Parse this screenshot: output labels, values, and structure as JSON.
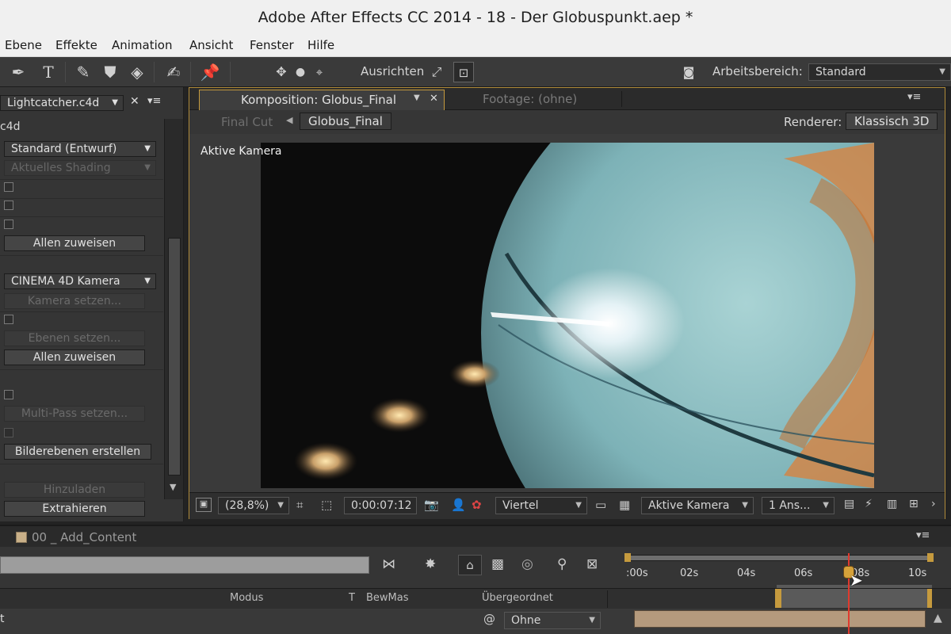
{
  "window": {
    "title": "Adobe After Effects CC 2014 - 18 - Der Globuspunkt.aep *"
  },
  "menu": {
    "items": [
      "Ebene",
      "Effekte",
      "Animation",
      "Ansicht",
      "Fenster",
      "Hilfe"
    ]
  },
  "toolbar": {
    "align_label": "Ausrichten",
    "workspace_label": "Arbeitsbereich:",
    "workspace_value": "Standard"
  },
  "effects_panel": {
    "tab_label": "Lightcatcher.c4d",
    "file_label": "c4d",
    "renderer_select": "Standard (Entwurf)",
    "shading_select": "Aktuelles Shading",
    "assign_all_1": "Allen zuweisen",
    "camera_select": "CINEMA 4D Kamera",
    "set_camera": "Kamera setzen...",
    "set_layers": "Ebenen setzen...",
    "assign_all_2": "Allen zuweisen",
    "set_multipass": "Multi-Pass setzen...",
    "create_layers": "Bilderebenen erstellen",
    "load": "Hinzuladen",
    "extract": "Extrahieren"
  },
  "composition": {
    "tab_label": "Komposition: Globus_Final",
    "footage_tab": "Footage: (ohne)",
    "breadcrumb_prev": "Final Cut",
    "breadcrumb_current": "Globus_Final",
    "renderer_label": "Renderer:",
    "renderer_value": "Klassisch 3D",
    "view_label": "Aktive Kamera"
  },
  "viewer_controls": {
    "zoom": "(28,8%)",
    "timecode": "0:00:07:12",
    "resolution": "Viertel",
    "camera": "Aktive Kamera",
    "views": "1 Ans..."
  },
  "timeline": {
    "tab_label": "00 _ Add_Content",
    "columns": {
      "mode": "Modus",
      "t": "T",
      "trkmat": "BewMas",
      "parent": "Übergeordnet"
    },
    "parent_value": "Ohne",
    "ruler_labels": [
      ":00s",
      "02s",
      "04s",
      "06s",
      "08s",
      "10s"
    ],
    "playhead_seconds": 7.5
  },
  "colors": {
    "accent": "#c59a3e",
    "playhead": "#e03a2e",
    "layer_bar": "#b59a7d"
  }
}
